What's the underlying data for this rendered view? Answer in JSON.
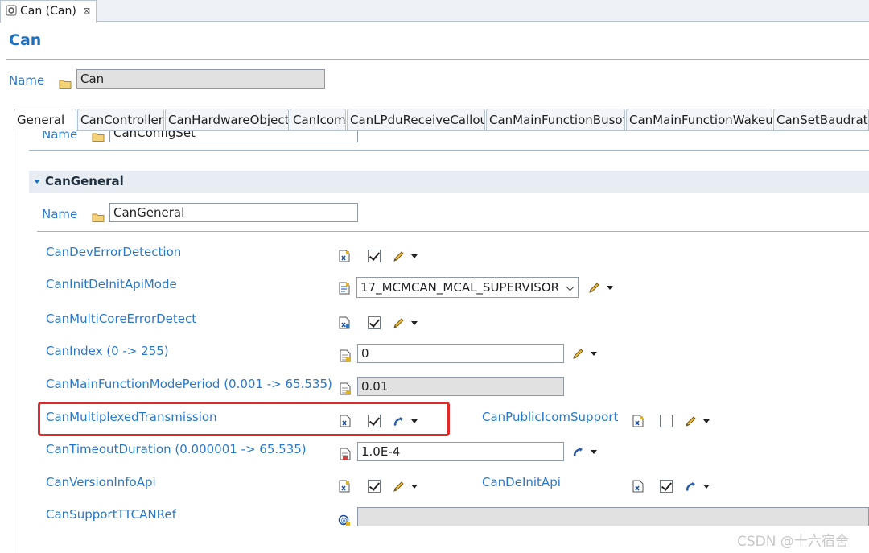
{
  "editor_tab": {
    "label": "Can (Can)",
    "close_symbol": "⊠"
  },
  "page": {
    "title": "Can"
  },
  "module_name": {
    "label": "Name",
    "value": "Can"
  },
  "subtabs": [
    {
      "label": "General"
    },
    {
      "label": "CanController"
    },
    {
      "label": "CanHardwareObject"
    },
    {
      "label": "CanIcom"
    },
    {
      "label": "CanLPduReceiveCallou"
    },
    {
      "label": "CanMainFunctionBusof"
    },
    {
      "label": "CanMainFunctionWakeu"
    },
    {
      "label": "CanSetBaudrate"
    }
  ],
  "config_set": {
    "label": "Name",
    "value": "CanConfigSet"
  },
  "section": {
    "title": "CanGeneral",
    "name_label": "Name",
    "name_value": "CanGeneral"
  },
  "params": {
    "dev_error_detection": {
      "label": "CanDevErrorDetection",
      "checked": true
    },
    "init_deinit_api_mode": {
      "label": "CanInitDeInitApiMode",
      "selected": "17_MCMCAN_MCAL_SUPERVISOR"
    },
    "multicore_error_detect": {
      "label": "CanMultiCoreErrorDetect",
      "checked": true
    },
    "index": {
      "label": "CanIndex (0 -> 255)",
      "value": "0"
    },
    "main_function_mode_period": {
      "label": "CanMainFunctionModePeriod (0.001 -> 65.535)",
      "value": "0.01"
    },
    "multiplexed_transmission": {
      "label": "CanMultiplexedTransmission",
      "checked": true
    },
    "public_icom_support": {
      "label": "CanPublicIcomSupport",
      "checked": false
    },
    "timeout_duration": {
      "label": "CanTimeoutDuration (0.000001 -> 65.535)",
      "value": "1.0E-4"
    },
    "version_info_api": {
      "label": "CanVersionInfoApi",
      "checked": true
    },
    "deinit_api": {
      "label": "CanDeInitApi",
      "checked": true
    },
    "support_ttcan_ref": {
      "label": "CanSupportTTCANRef",
      "value": ""
    }
  },
  "watermark": "CSDN @十六宿舍",
  "colors": {
    "accent": "#2a79c8",
    "title": "#1b6fbf",
    "highlight": "#e02a2a"
  }
}
